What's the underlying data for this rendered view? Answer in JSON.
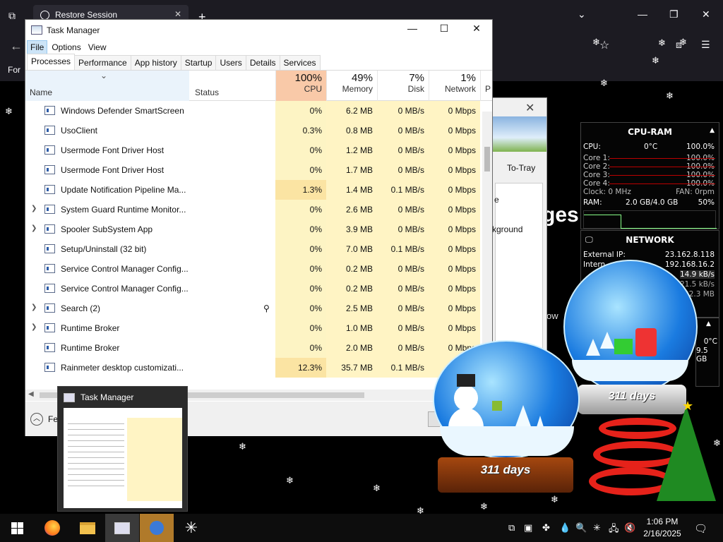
{
  "browser": {
    "tab_title": "Restore Session",
    "page_fragment_left": "For",
    "page_fragment_heading": "ges",
    "page_fragment_text": "ow"
  },
  "task_manager": {
    "title": "Task Manager",
    "menu": [
      "File",
      "Options",
      "View"
    ],
    "tabs": [
      "Processes",
      "Performance",
      "App history",
      "Startup",
      "Users",
      "Details",
      "Services"
    ],
    "columns": {
      "name": "Name",
      "status": "Status",
      "cpu": {
        "pct": "100%",
        "label": "CPU"
      },
      "memory": {
        "pct": "49%",
        "label": "Memory"
      },
      "disk": {
        "pct": "7%",
        "label": "Disk"
      },
      "network": {
        "pct": "1%",
        "label": "Network"
      },
      "power": "P"
    },
    "rows": [
      {
        "name": "Windows Defender SmartScreen",
        "cpu": "0%",
        "mem": "6.2 MB",
        "disk": "0 MB/s",
        "net": "0 Mbps",
        "expandable": false
      },
      {
        "name": "UsoClient",
        "cpu": "0.3%",
        "mem": "0.8 MB",
        "disk": "0 MB/s",
        "net": "0 Mbps",
        "expandable": false
      },
      {
        "name": "Usermode Font Driver Host",
        "cpu": "0%",
        "mem": "1.2 MB",
        "disk": "0 MB/s",
        "net": "0 Mbps",
        "expandable": false
      },
      {
        "name": "Usermode Font Driver Host",
        "cpu": "0%",
        "mem": "1.7 MB",
        "disk": "0 MB/s",
        "net": "0 Mbps",
        "expandable": false
      },
      {
        "name": "Update Notification Pipeline Ma...",
        "cpu": "1.3%",
        "mem": "1.4 MB",
        "disk": "0.1 MB/s",
        "net": "0 Mbps",
        "expandable": false
      },
      {
        "name": "System Guard Runtime Monitor...",
        "cpu": "0%",
        "mem": "2.6 MB",
        "disk": "0 MB/s",
        "net": "0 Mbps",
        "expandable": true
      },
      {
        "name": "Spooler SubSystem App",
        "cpu": "0%",
        "mem": "3.9 MB",
        "disk": "0 MB/s",
        "net": "0 Mbps",
        "expandable": true
      },
      {
        "name": "Setup/Uninstall (32 bit)",
        "cpu": "0%",
        "mem": "7.0 MB",
        "disk": "0.1 MB/s",
        "net": "0 Mbps",
        "expandable": false
      },
      {
        "name": "Service Control Manager Config...",
        "cpu": "0%",
        "mem": "0.2 MB",
        "disk": "0 MB/s",
        "net": "0 Mbps",
        "expandable": false
      },
      {
        "name": "Service Control Manager Config...",
        "cpu": "0%",
        "mem": "0.2 MB",
        "disk": "0 MB/s",
        "net": "0 Mbps",
        "expandable": false
      },
      {
        "name": "Search (2)",
        "cpu": "0%",
        "mem": "2.5 MB",
        "disk": "0 MB/s",
        "net": "0 Mbps",
        "expandable": true
      },
      {
        "name": "Runtime Broker",
        "cpu": "0%",
        "mem": "1.0 MB",
        "disk": "0 MB/s",
        "net": "0 Mbps",
        "expandable": true
      },
      {
        "name": "Runtime Broker",
        "cpu": "0%",
        "mem": "2.0 MB",
        "disk": "0 MB/s",
        "net": "0 Mbps",
        "expandable": false
      },
      {
        "name": "Rainmeter desktop customizati...",
        "cpu": "12.3%",
        "mem": "35.7 MB",
        "disk": "0.1 MB/s",
        "net": "0 Mbps",
        "expandable": false
      }
    ],
    "footer_label": "Fe"
  },
  "behind_window": {
    "tray_label": "To-Tray",
    "fragment_e": "e",
    "fragment_kground": "kground"
  },
  "cpu_ram": {
    "title": "CPU-RAM",
    "cpu_label": "CPU:",
    "cpu_temp": "0°C",
    "cpu_pct": "100.0%",
    "cores": [
      {
        "label": "Core 1:",
        "value": "100.0%"
      },
      {
        "label": "Core 2:",
        "value": "100.0%"
      },
      {
        "label": "Core 3:",
        "value": "100.0%"
      },
      {
        "label": "Core 4:",
        "value": "100.0%"
      }
    ],
    "clock": "Clock: 0 MHz",
    "fan": "FAN: 0rpm",
    "ram_label": "RAM:",
    "ram_value": "2.0 GB/4.0 GB",
    "ram_pct": "50%"
  },
  "network": {
    "title": "NETWORK",
    "external_label": "External IP:",
    "external_ip": "23.162.8.118",
    "internal_label": "Intern",
    "internal_ip": "192.168.16.2",
    "up": "14.9 kB/s",
    "down": "21.5 kB/s",
    "total": "22.3 MB",
    "temp": "0°C",
    "disk": "9.5 GB"
  },
  "thumbnail": {
    "title": "Task Manager"
  },
  "globes": {
    "days_1": "311 days",
    "days_2": "311 days"
  },
  "clock": {
    "time": "1:06 PM",
    "date": "2/16/2025"
  }
}
